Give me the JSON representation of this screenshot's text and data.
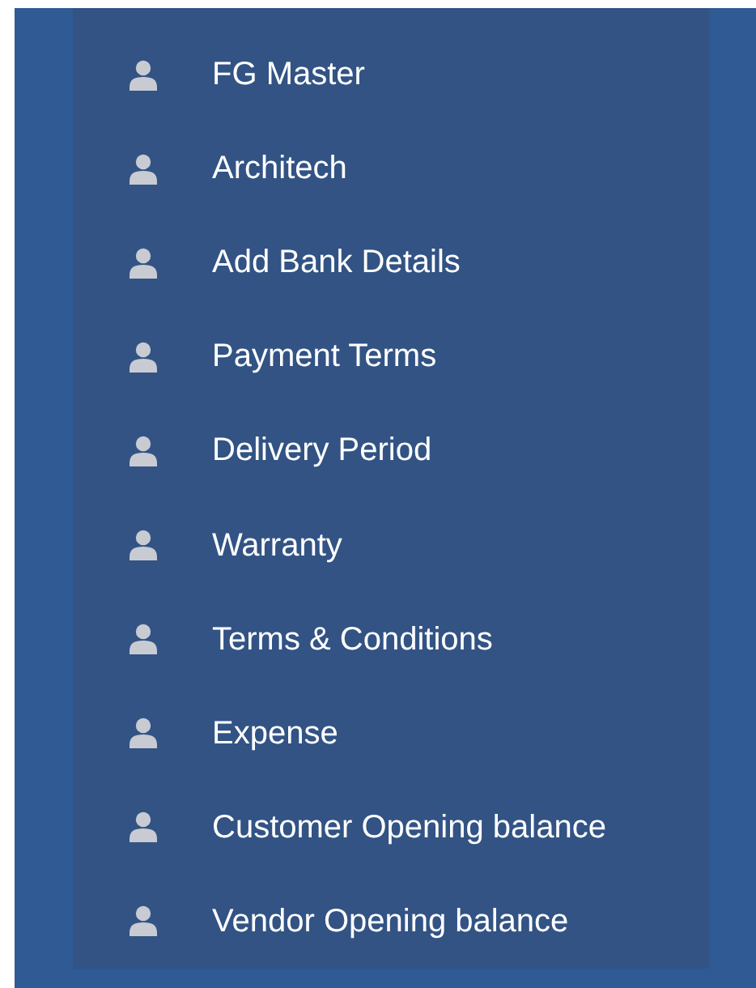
{
  "menu": {
    "items": [
      {
        "label": "FG Master"
      },
      {
        "label": "Architech"
      },
      {
        "label": "Add Bank Details"
      },
      {
        "label": "Payment Terms"
      },
      {
        "label": "Delivery Period"
      },
      {
        "label": "Warranty"
      },
      {
        "label": "Terms & Conditions"
      },
      {
        "label": "Expense"
      },
      {
        "label": "Customer Opening balance"
      },
      {
        "label": "Vendor Opening balance"
      }
    ]
  }
}
